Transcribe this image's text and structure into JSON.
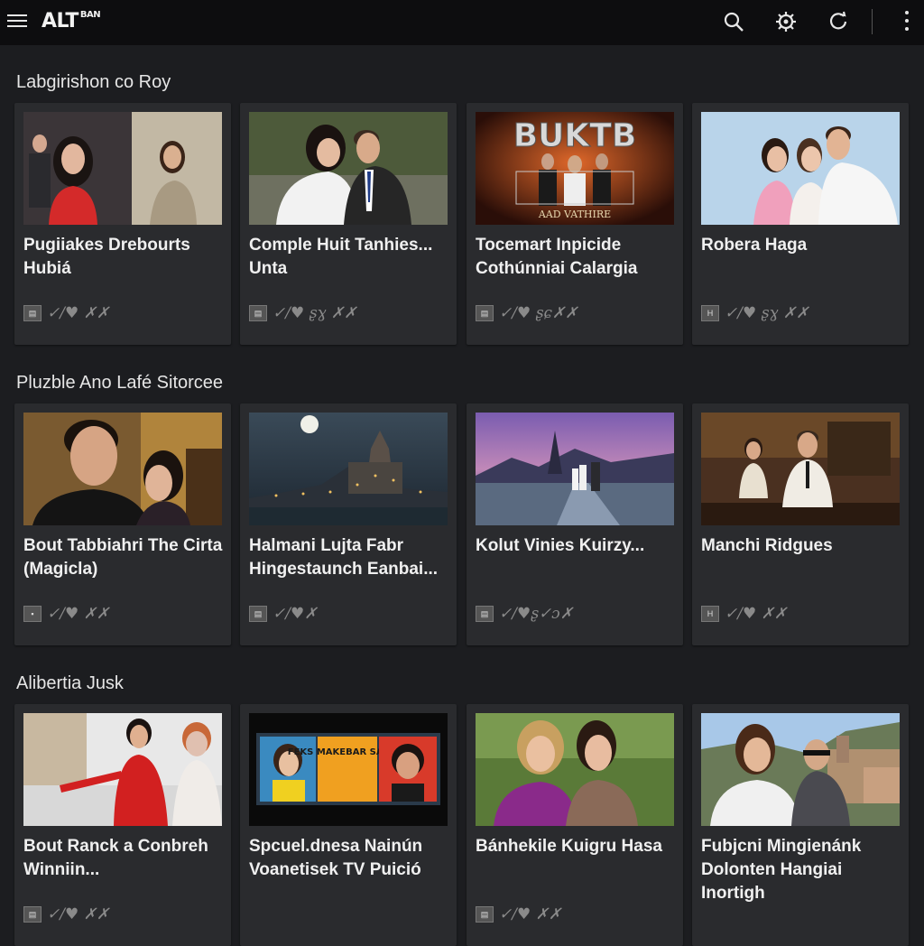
{
  "app": {
    "logo": "ALT",
    "logo_small": "BAN"
  },
  "toolbar": {
    "menu_icon": "hamburger-icon",
    "search_icon": "search-icon",
    "settings_icon": "gear-icon",
    "refresh_icon": "refresh-icon",
    "more_icon": "kebab-menu-icon"
  },
  "sections": [
    {
      "title": "Labgirishon co Roy",
      "cards": [
        {
          "title": "Pugiiakes Drebourts Hubiá",
          "meta": "✓/♥ ✗✗",
          "badge": "▤"
        },
        {
          "title": "Comple Huit Tanhies... Unta",
          "meta": "✓/♥ ʂɣ ✗✗",
          "badge": "▤"
        },
        {
          "title": "Tocemart Inpicide Cothúnniai Calargia",
          "meta": "✓/♥ ʂɕ✗✗",
          "badge": "▤"
        },
        {
          "title": "Robera Haga",
          "meta": "✓/♥ ʂɣ ✗✗",
          "badge": "H"
        }
      ]
    },
    {
      "title": "Pluzble Ano Lafé Sitorcee",
      "cards": [
        {
          "title": "Bout Tabbiahri The Cirta (Magicla)",
          "meta": "✓/♥ ✗✗",
          "badge": "▪"
        },
        {
          "title": "Halmani Lujta Fabr Hingestaunch Eanbai...",
          "meta": "✓/♥✗",
          "badge": "▤"
        },
        {
          "title": "Kolut Vinies Kuirzy...",
          "meta": "✓/♥ʂ✓ɔ✗",
          "badge": "▤"
        },
        {
          "title": "Manchi Ridgues",
          "meta": "✓/♥ ✗✗",
          "badge": "H"
        }
      ]
    },
    {
      "title": "Alibertia Jusk",
      "cards": [
        {
          "title": "Bout Ranck a Conbreh Winniin...",
          "meta": "✓/♥ ✗✗",
          "badge": "▤"
        },
        {
          "title": "Spcuel.dnesa Nainún Voanetisek TV Puició",
          "meta": "",
          "badge": ""
        },
        {
          "title": "Bánhekile Kuigru Hasa",
          "meta": "✓/♥ ✗✗",
          "badge": "▤"
        },
        {
          "title": "Fubjcni Mingienánk Dolonten Hangiai Inortigh",
          "meta": "",
          "badge": ""
        }
      ]
    }
  ],
  "posters": {
    "buktb_title": "BUKTB",
    "buktb_sub": "AAD VATHIRE",
    "feks_title": "FEKS MAKEBAR SAAUIC"
  }
}
